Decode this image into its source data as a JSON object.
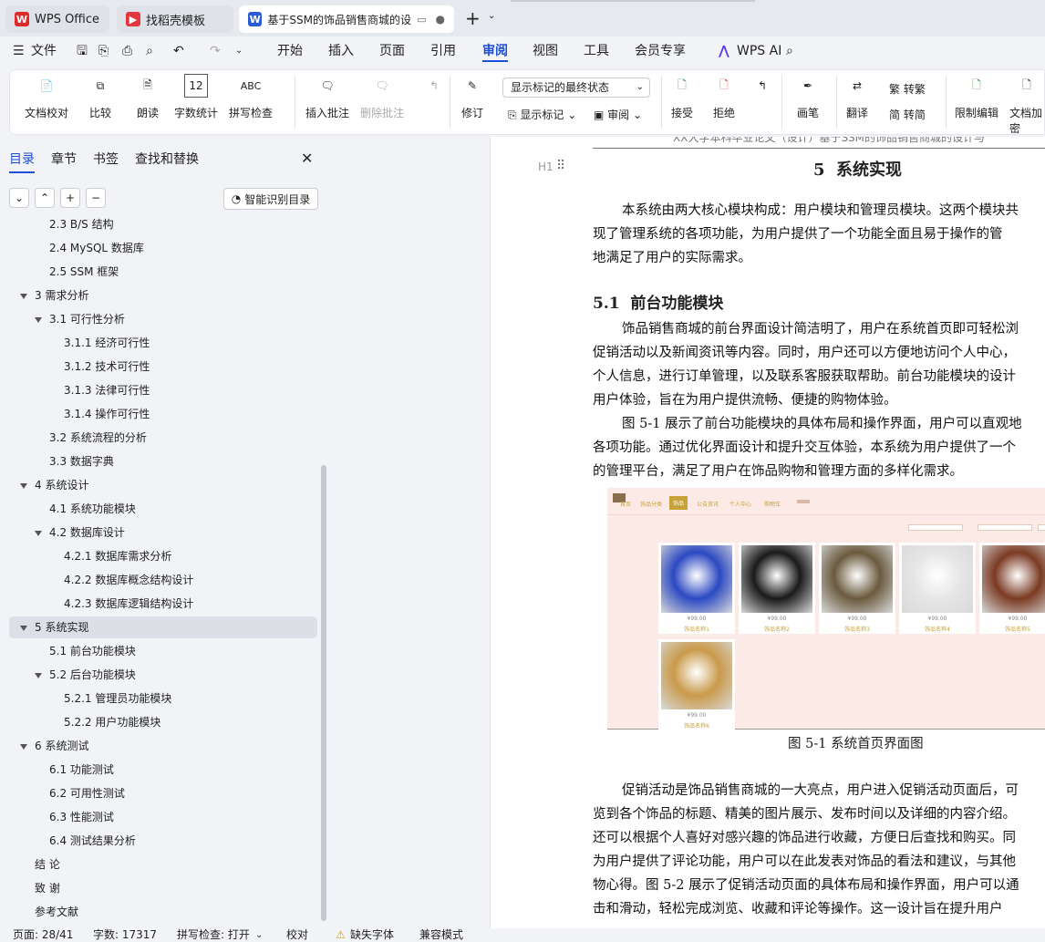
{
  "tabs": [
    {
      "label": "WPS Office",
      "icon": "wps-logo-icon"
    },
    {
      "label": "找稻壳模板",
      "icon": "docer-icon"
    },
    {
      "label": "基于SSM的饰品销售商城的设",
      "icon": "word-doc-icon"
    }
  ],
  "new_tab": "+",
  "menu": {
    "file": "文件",
    "items": [
      "开始",
      "插入",
      "页面",
      "引用",
      "审阅",
      "视图",
      "工具",
      "会员专享"
    ],
    "active": "审阅",
    "ai": "WPS AI"
  },
  "ribbon": {
    "doc_check": "文档校对",
    "compare": "比较",
    "read_aloud": "朗读",
    "word_count": "字数统计",
    "spell_check": "拼写检查",
    "insert_comment": "插入批注",
    "delete_comment": "删除批注",
    "track": "修订",
    "display_mode": "显示标记的最终状态",
    "show_markup": "显示标记",
    "review": "审阅",
    "accept": "接受",
    "reject": "拒绝",
    "pen": "画笔",
    "translate": "翻译",
    "trad": "繁转简",
    "trad_label_top": "转繁",
    "trad_label_bottom": "转简",
    "restrict": "限制编辑",
    "encrypt": "文档加密"
  },
  "sidebar": {
    "tabs": [
      "目录",
      "章节",
      "书签",
      "查找和替换"
    ],
    "active_tab": "目录",
    "ai_toc": "智能识别目录",
    "toc": [
      {
        "text": "2.3 B/S 结构",
        "level": 2,
        "arrow": false
      },
      {
        "text": "2.4 MySQL 数据库",
        "level": 2,
        "arrow": false
      },
      {
        "text": "2.5 SSM 框架",
        "level": 2,
        "arrow": false
      },
      {
        "text": "3 需求分析",
        "level": 1,
        "arrow": true
      },
      {
        "text": "3.1  可行性分析",
        "level": 2,
        "arrow": true
      },
      {
        "text": "3.1.1  经济可行性",
        "level": 3,
        "arrow": false
      },
      {
        "text": "3.1.2  技术可行性",
        "level": 3,
        "arrow": false
      },
      {
        "text": "3.1.3  法律可行性",
        "level": 3,
        "arrow": false
      },
      {
        "text": "3.1.4  操作可行性",
        "level": 3,
        "arrow": false
      },
      {
        "text": "3.2 系统流程的分析",
        "level": 2,
        "arrow": false
      },
      {
        "text": "3.3  数据字典",
        "level": 2,
        "arrow": false
      },
      {
        "text": "4 系统设计",
        "level": 1,
        "arrow": true
      },
      {
        "text": "4.1 系统功能模块",
        "level": 2,
        "arrow": false
      },
      {
        "text": "4.2  数据库设计",
        "level": 2,
        "arrow": true
      },
      {
        "text": "4.2.1  数据库需求分析",
        "level": 3,
        "arrow": false
      },
      {
        "text": "4.2.2  数据库概念结构设计",
        "level": 3,
        "arrow": false
      },
      {
        "text": "4.2.3  数据库逻辑结构设计",
        "level": 3,
        "arrow": false
      },
      {
        "text": "5  系统实现",
        "level": 1,
        "arrow": true,
        "selected": true
      },
      {
        "text": "5.1  前台功能模块",
        "level": 2,
        "arrow": false
      },
      {
        "text": "5.2 后台功能模块",
        "level": 2,
        "arrow": true
      },
      {
        "text": "5.2.1 管理员功能模块",
        "level": 3,
        "arrow": false
      },
      {
        "text": "5.2.2 用户功能模块",
        "level": 3,
        "arrow": false
      },
      {
        "text": "6  系统测试",
        "level": 1,
        "arrow": true
      },
      {
        "text": "6.1  功能测试",
        "level": 2,
        "arrow": false
      },
      {
        "text": "6.2  可用性测试",
        "level": 2,
        "arrow": false
      },
      {
        "text": "6.3  性能测试",
        "level": 2,
        "arrow": false
      },
      {
        "text": "6.4  测试结果分析",
        "level": 2,
        "arrow": false
      },
      {
        "text": "结    论",
        "level": 1,
        "arrow": false
      },
      {
        "text": "致    谢",
        "level": 1,
        "arrow": false
      },
      {
        "text": "参考文献",
        "level": 1,
        "arrow": false
      }
    ]
  },
  "document": {
    "header_text": "XX大学本科毕业论文（设计）基于SSM的饰品销售商城的设计与",
    "heading_marker": "H1",
    "chapter_title": "5  系统实现",
    "intro": [
      "本系统由两大核心模块构成：用户模块和管理员模块。这两个模块共",
      "现了管理系统的各项功能，为用户提供了一个功能全面且易于操作的管",
      "地满足了用户的实际需求。"
    ],
    "section_title": "5.1  前台功能模块",
    "para1": [
      "饰品销售商城的前台界面设计简洁明了，用户在系统首页即可轻松浏",
      "促销活动以及新闻资讯等内容。同时，用户还可以方便地访问个人中心，",
      "个人信息，进行订单管理，以及联系客服获取帮助。前台功能模块的设计",
      "用户体验，旨在为用户提供流畅、便捷的购物体验。",
      "图 5-1 展示了前台功能模块的具体布局和操作界面，用户可以直观地",
      "各项功能。通过优化界面设计和提升交互体验，本系统为用户提供了一个",
      "的管理平台，满足了用户在饰品购物和管理方面的多样化需求。"
    ],
    "figure_caption": "图 5-1 系统首页界面图",
    "figure": {
      "nav": [
        "首页",
        "饰品分类",
        "饰品",
        "公告资讯",
        "个人中心",
        "购物车"
      ],
      "products": [
        {
          "price": "¥99.00",
          "name": "饰品名称1",
          "color": "#2b49c2"
        },
        {
          "price": "¥99.00",
          "name": "饰品名称2",
          "color": "#1a1a1a"
        },
        {
          "price": "¥99.00",
          "name": "饰品名称3",
          "color": "#6b5a3e"
        },
        {
          "price": "¥99.00",
          "name": "饰品名称4",
          "color": "#e6e6e6"
        },
        {
          "price": "¥99.00",
          "name": "饰品名称5",
          "color": "#7a3a22"
        },
        {
          "price": "¥99.00",
          "name": "饰品名称6",
          "color": "#c99a4a"
        }
      ]
    },
    "para2": [
      "促销活动是饰品销售商城的一大亮点，用户进入促销活动页面后，可",
      "览到各个饰品的标题、精美的图片展示、发布时间以及详细的内容介绍。",
      "还可以根据个人喜好对感兴趣的饰品进行收藏，方便日后查找和购买。同",
      "为用户提供了评论功能，用户可以在此发表对饰品的看法和建议，与其他",
      "物心得。图 5-2 展示了促销活动页面的具体布局和操作界面，用户可以通",
      "击和滑动，轻松完成浏览、收藏和评论等操作。这一设计旨在提升用户"
    ]
  },
  "status": {
    "page": "页面: 28/41",
    "words": "字数: 17317",
    "spell": "拼写检查: 打开",
    "proof": "校对",
    "missing_font": "缺失字体",
    "compat": "兼容模式"
  },
  "colors": {
    "accent": "#1f4fd6",
    "wps_red": "#e02a2a"
  }
}
